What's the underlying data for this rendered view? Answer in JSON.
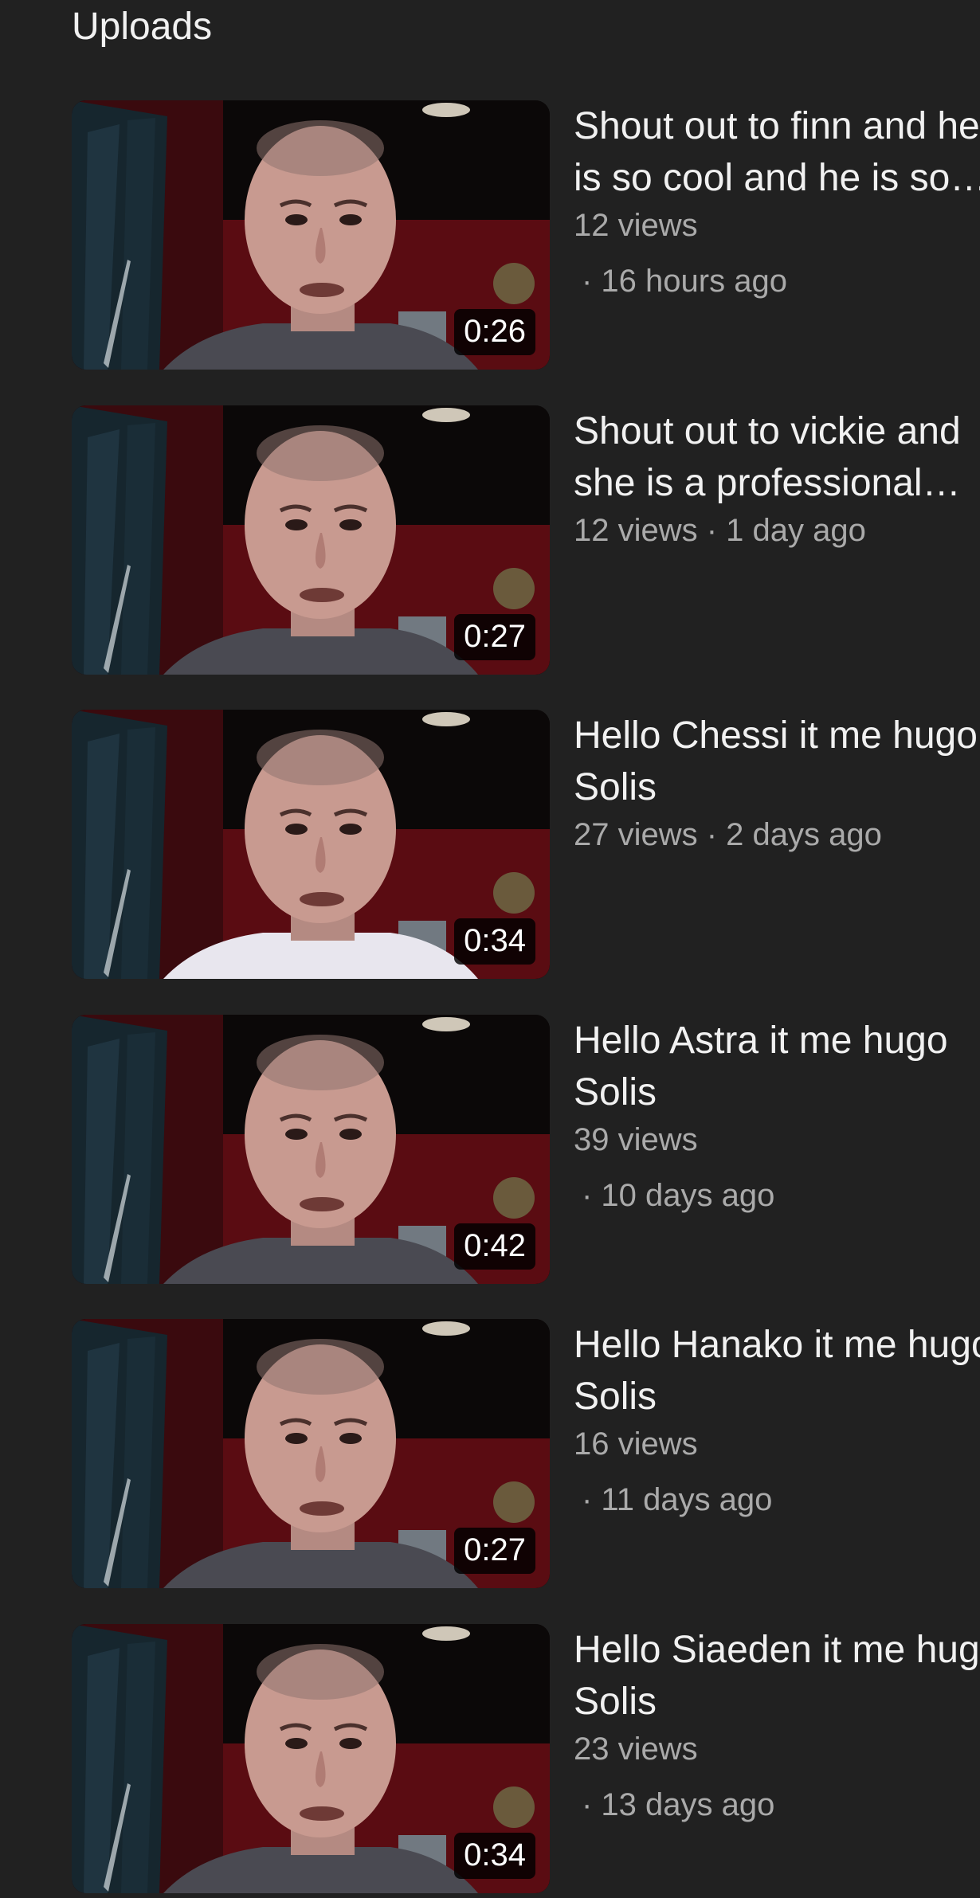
{
  "section": {
    "title": "Uploads"
  },
  "videos": [
    {
      "title": "Shout out to finn and he is so cool and he is so…",
      "views": "12 views",
      "age": "· 16 hours ago",
      "duration": "0:26",
      "shirt": "#4a4a52"
    },
    {
      "title": "Shout out to vickie and she is a professional…",
      "views": "12 views · 1 day ago",
      "age": "",
      "duration": "0:27",
      "shirt": "#4a4a52"
    },
    {
      "title": "Hello Chessi it me hugo Solis",
      "views": "27 views · 2 days ago",
      "age": "",
      "duration": "0:34",
      "shirt": "#e8e6ee"
    },
    {
      "title": "Hello Astra it me hugo Solis",
      "views": "39 views",
      "age": "· 10 days ago",
      "duration": "0:42",
      "shirt": "#4a4a52"
    },
    {
      "title": "Hello Hanako it me hugo Solis",
      "views": "16 views",
      "age": "· 11 days ago",
      "duration": "0:27",
      "shirt": "#4a4a52"
    },
    {
      "title": "Hello Siaeden it me hugo Solis",
      "views": "23 views",
      "age": "· 13 days ago",
      "duration": "0:34",
      "shirt": "#4a4a52"
    }
  ]
}
